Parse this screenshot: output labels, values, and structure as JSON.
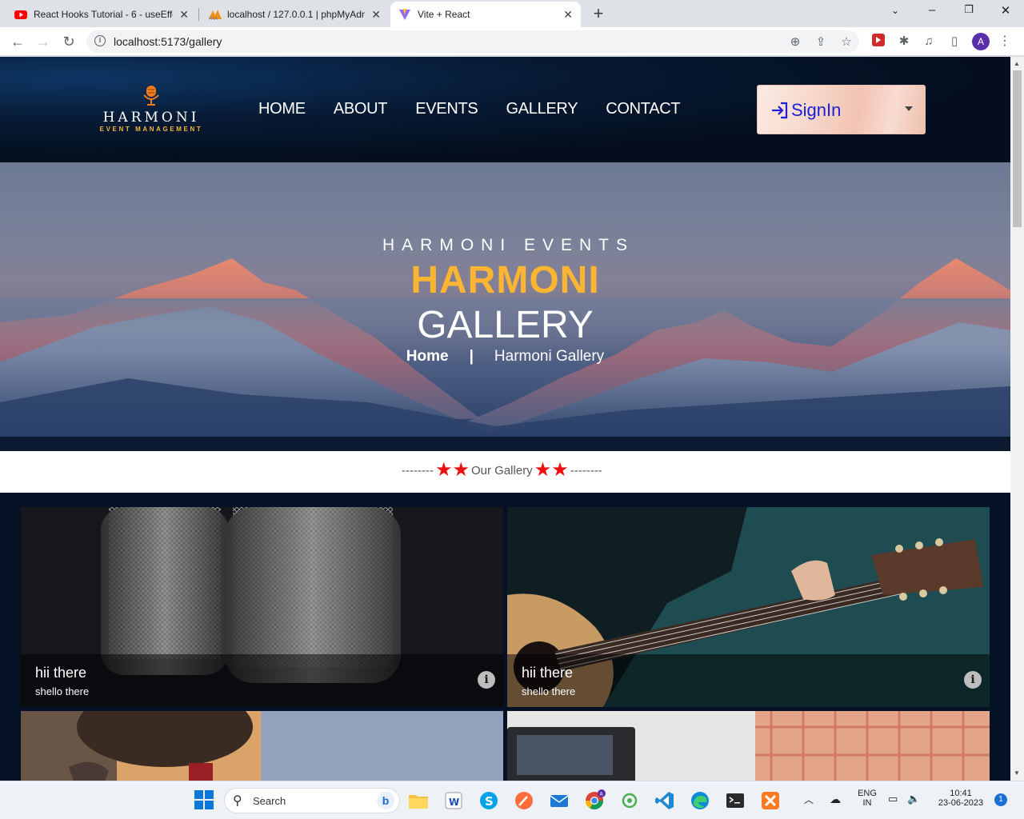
{
  "browser": {
    "tabs": [
      {
        "title": "React Hooks Tutorial - 6 - useEffe",
        "favicon": "youtube-icon"
      },
      {
        "title": "localhost / 127.0.0.1 | phpMyAdm",
        "favicon": "phpmyadmin-icon"
      },
      {
        "title": "Vite + React",
        "favicon": "vite-icon",
        "active": true
      }
    ],
    "url": "localhost:5173/gallery",
    "profile_initial": "A"
  },
  "site": {
    "logo": {
      "brand": "HARMONI",
      "tagline": "EVENT MANAGEMENT"
    },
    "nav": [
      "HOME",
      "ABOUT",
      "EVENTS",
      "GALLERY",
      "CONTACT"
    ],
    "signin_label": "SignIn"
  },
  "hero": {
    "subtitle": "HARMONI EVENTS",
    "title_line1": "HARMONI",
    "title_line2": "GALLERY",
    "breadcrumb_home": "Home",
    "breadcrumb_sep": "|",
    "breadcrumb_current": "Harmoni Gallery"
  },
  "gallery": {
    "heading_left_dashes": "--------",
    "heading": "Our Gallery",
    "heading_right_dashes": "--------",
    "items": [
      {
        "title": "hii there",
        "subtitle": "shello there",
        "image": "microphones"
      },
      {
        "title": "hii there",
        "subtitle": "shello there",
        "image": "guitar"
      },
      {
        "title": "",
        "subtitle": "",
        "image": "person-wine"
      },
      {
        "title": "",
        "subtitle": "",
        "image": "laptop-plaid-shirt"
      }
    ]
  },
  "taskbar": {
    "search_placeholder": "Search",
    "lang_line1": "ENG",
    "lang_line2": "IN",
    "time": "10:41",
    "date": "23-06-2023",
    "notification_count": "1"
  }
}
